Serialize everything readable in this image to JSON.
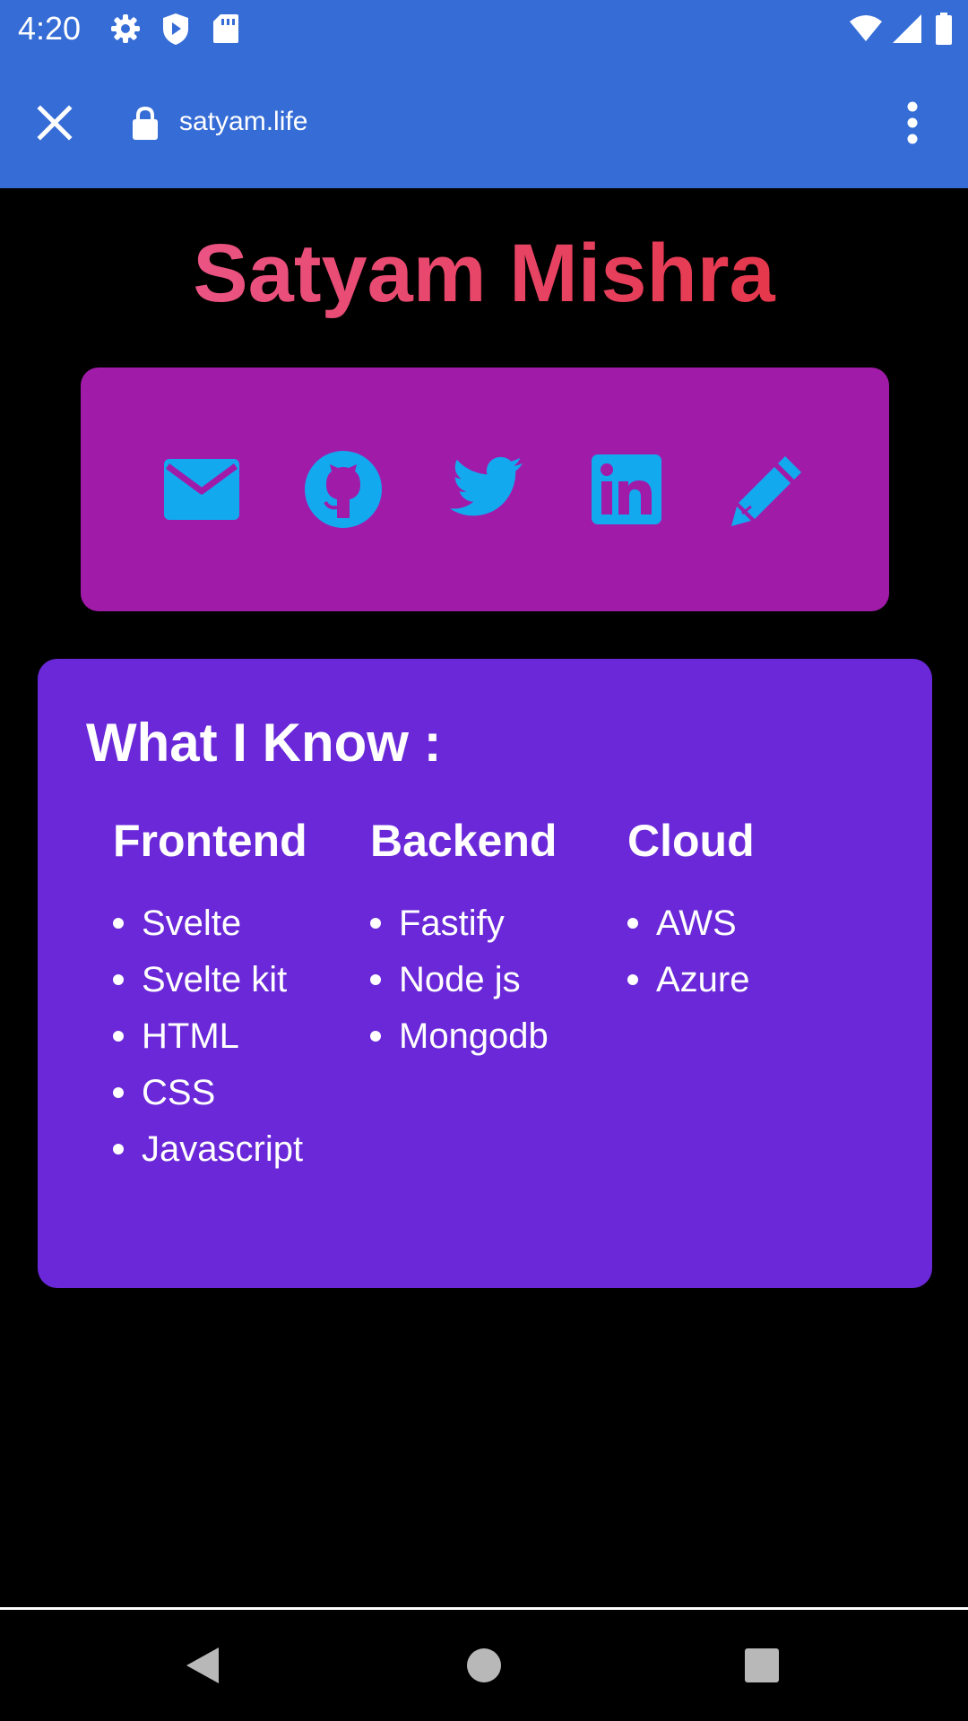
{
  "status_bar": {
    "time": "4:20",
    "left_icons": [
      "settings-icon",
      "play-protect-icon",
      "sd-card-icon"
    ],
    "right_icons": [
      "wifi-icon",
      "signal-icon",
      "battery-icon"
    ]
  },
  "toolbar": {
    "url": "satyam.life",
    "close_icon": "close-icon",
    "lock_icon": "lock-icon",
    "menu_icon": "more-vert-icon"
  },
  "page": {
    "title": "Satyam Mishra",
    "title_gradient": [
      "#ec5d95",
      "#e32e3a"
    ],
    "social_links": [
      {
        "name": "email",
        "icon": "mail-icon"
      },
      {
        "name": "github",
        "icon": "github-icon"
      },
      {
        "name": "twitter",
        "icon": "twitter-icon"
      },
      {
        "name": "linkedin",
        "icon": "linkedin-icon"
      },
      {
        "name": "blog",
        "icon": "pencil-icon"
      }
    ],
    "skills": {
      "heading": "What I Know :",
      "columns": [
        {
          "title": "Frontend",
          "items": [
            "Svelte",
            "Svelte kit",
            "HTML",
            "CSS",
            "Javascript"
          ]
        },
        {
          "title": "Backend",
          "items": [
            "Fastify",
            "Node js",
            "Mongodb"
          ]
        },
        {
          "title": "Cloud",
          "items": [
            "AWS",
            "Azure"
          ]
        }
      ]
    }
  },
  "navigation": {
    "buttons": [
      "back-icon",
      "home-icon",
      "recents-icon"
    ]
  },
  "colors": {
    "chrome": "#356cd6",
    "background": "#000000",
    "social_card": "#a11ba9",
    "skills_card": "#6a28d8",
    "icon_accent": "#12a9ef"
  }
}
